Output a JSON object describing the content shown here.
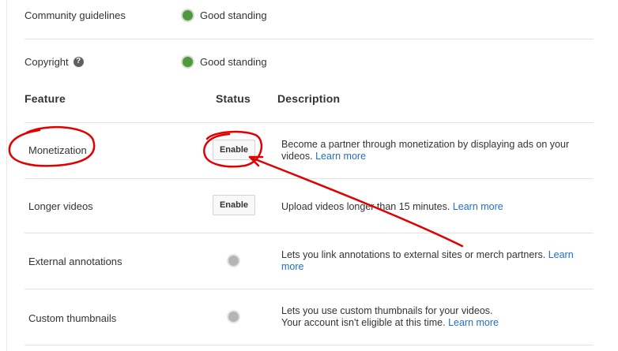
{
  "status": [
    {
      "label": "Community guidelines",
      "value": "Good standing"
    },
    {
      "label": "Copyright",
      "help_icon": "help-icon",
      "value": "Good standing"
    }
  ],
  "table": {
    "headers": {
      "feature": "Feature",
      "status": "Status",
      "description": "Description"
    },
    "rows": [
      {
        "name": "Monetization",
        "button": "Enable",
        "desc": "Become a partner through monetization by displaying ads on your videos.",
        "link": "Learn more"
      },
      {
        "name": "Longer videos",
        "button": "Enable",
        "desc": "Upload videos longer than 15 minutes.",
        "link": "Learn more"
      },
      {
        "name": "External annotations",
        "desc": "Lets you link annotations to external sites or merch partners.",
        "link": "Learn more"
      },
      {
        "name": "Custom thumbnails",
        "desc": "Lets you use custom thumbnails for your videos.",
        "desc2": "Your account isn't eligible at this time.",
        "link": "Learn more"
      }
    ]
  },
  "colors": {
    "good": "#4c9a39",
    "link": "#1f6fc5",
    "annotation": "#e00000"
  }
}
